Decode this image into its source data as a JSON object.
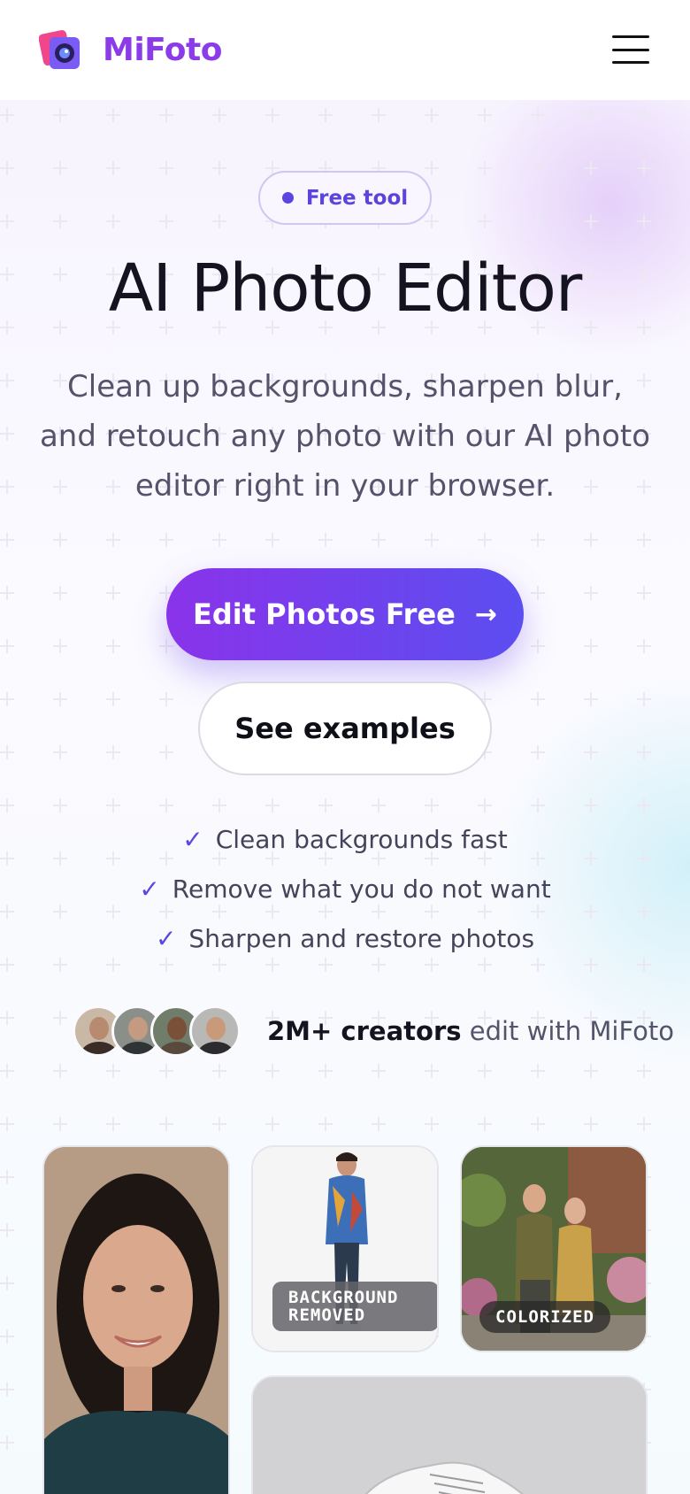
{
  "header": {
    "logo_text": "MiFoto",
    "logo_icon": "camera-photos-icon",
    "menu_icon": "hamburger-menu-icon"
  },
  "hero": {
    "badge": "Free tool",
    "title": "AI Photo Editor",
    "subtitle": "Clean up backgrounds, sharpen blur, and retouch any photo with our AI photo editor right in your browser.",
    "cta_primary": "Edit Photos Free",
    "cta_primary_icon": "arrow-right-icon",
    "cta_secondary": "See examples"
  },
  "features": [
    "Clean backgrounds fast",
    "Remove what you do not want",
    "Sharpen and restore photos"
  ],
  "social_proof": {
    "strong": "2M+ creators",
    "rest": " edit with MiFoto"
  },
  "gallery": {
    "bg_tag": "BACKGROUND REMOVED",
    "color_tag": "COLORIZED"
  },
  "colors": {
    "brand": "#8b3ce8",
    "accent": "#5b45e0",
    "cta_gradient_start": "#8a33ea",
    "cta_gradient_end": "#5b4ef0"
  }
}
